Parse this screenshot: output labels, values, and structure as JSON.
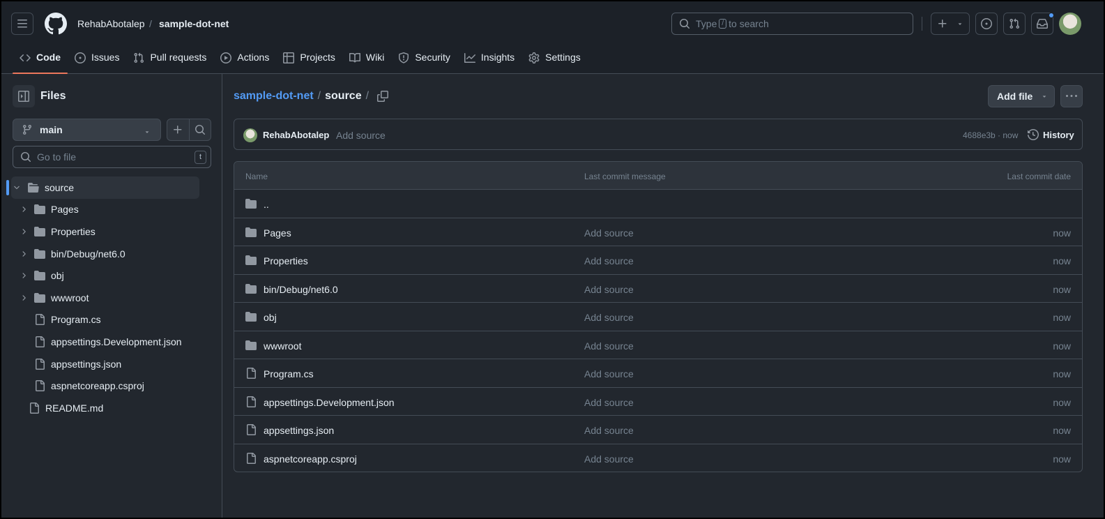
{
  "header": {
    "owner": "RehabAbotalep",
    "separator": "/",
    "repo": "sample-dot-net",
    "search_prefix": "Type",
    "search_key": "/",
    "search_suffix": "to search",
    "accent": "#539bf5"
  },
  "tabs": [
    {
      "label": "Code",
      "icon": "code-icon"
    },
    {
      "label": "Issues",
      "icon": "issue-icon"
    },
    {
      "label": "Pull requests",
      "icon": "pull-request-icon"
    },
    {
      "label": "Actions",
      "icon": "play-icon"
    },
    {
      "label": "Projects",
      "icon": "table-icon"
    },
    {
      "label": "Wiki",
      "icon": "book-icon"
    },
    {
      "label": "Security",
      "icon": "shield-icon"
    },
    {
      "label": "Insights",
      "icon": "graph-icon"
    },
    {
      "label": "Settings",
      "icon": "gear-icon"
    }
  ],
  "sidebar": {
    "title": "Files",
    "branch": "main",
    "goto_placeholder": "Go to file",
    "goto_key": "t",
    "tree": [
      {
        "label": "source",
        "type": "folder-open"
      },
      {
        "label": "Pages",
        "type": "folder"
      },
      {
        "label": "Properties",
        "type": "folder"
      },
      {
        "label": "bin/Debug/net6.0",
        "type": "folder"
      },
      {
        "label": "obj",
        "type": "folder"
      },
      {
        "label": "wwwroot",
        "type": "folder"
      },
      {
        "label": "Program.cs",
        "type": "file"
      },
      {
        "label": "appsettings.Development.json",
        "type": "file"
      },
      {
        "label": "appsettings.json",
        "type": "file"
      },
      {
        "label": "aspnetcoreapp.csproj",
        "type": "file"
      },
      {
        "label": "README.md",
        "type": "file"
      }
    ]
  },
  "main": {
    "path_repo": "sample-dot-net",
    "path_sep": "/",
    "path_current": "source",
    "path_trailing": "/",
    "add_file": "Add file",
    "commit": {
      "author": "RehabAbotalep",
      "message": "Add source",
      "sha_time": "4688e3b · now",
      "history": "History"
    },
    "columns": {
      "name": "Name",
      "message": "Last commit message",
      "date": "Last commit date"
    },
    "parent": "..",
    "rows": [
      {
        "name": "Pages",
        "type": "folder",
        "message": "Add source",
        "date": "now"
      },
      {
        "name": "Properties",
        "type": "folder",
        "message": "Add source",
        "date": "now"
      },
      {
        "name": "bin/Debug/net6.0",
        "type": "folder",
        "message": "Add source",
        "date": "now"
      },
      {
        "name": "obj",
        "type": "folder",
        "message": "Add source",
        "date": "now"
      },
      {
        "name": "wwwroot",
        "type": "folder",
        "message": "Add source",
        "date": "now"
      },
      {
        "name": "Program.cs",
        "type": "file",
        "message": "Add source",
        "date": "now"
      },
      {
        "name": "appsettings.Development.json",
        "type": "file",
        "message": "Add source",
        "date": "now"
      },
      {
        "name": "appsettings.json",
        "type": "file",
        "message": "Add source",
        "date": "now"
      },
      {
        "name": "aspnetcoreapp.csproj",
        "type": "file",
        "message": "Add source",
        "date": "now"
      }
    ]
  }
}
